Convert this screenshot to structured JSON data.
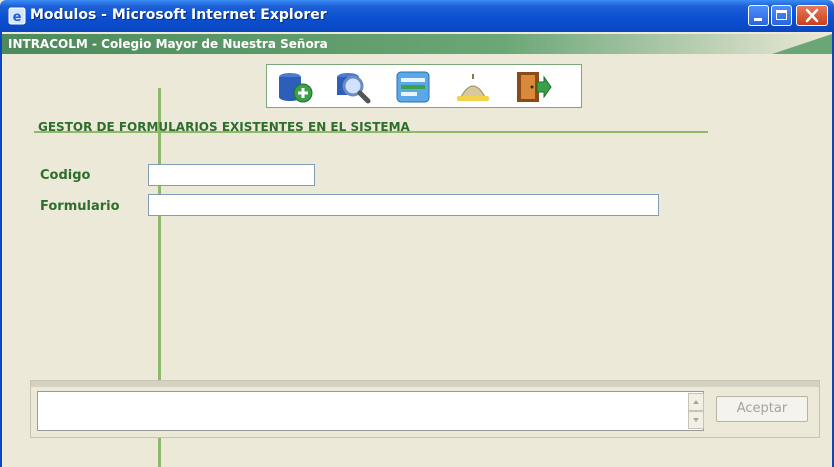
{
  "window": {
    "title": "Modulos - Microsoft Internet Explorer"
  },
  "banner": {
    "text": "INTRACOLM - Colegio Mayor de Nuestra Señora"
  },
  "toolbar": {
    "tools": [
      {
        "name": "add-record",
        "icon": "database-add-icon"
      },
      {
        "name": "search",
        "icon": "magnifier-icon"
      },
      {
        "name": "document",
        "icon": "document-icon"
      },
      {
        "name": "clear",
        "icon": "bell-icon"
      },
      {
        "name": "exit",
        "icon": "door-exit-icon"
      }
    ]
  },
  "section": {
    "title": "GESTOR DE FORMULARIOS EXISTENTES EN EL SISTEMA"
  },
  "form": {
    "codigo_label": "Codigo",
    "codigo_value": "",
    "formulario_label": "Formulario",
    "formulario_value": ""
  },
  "footer": {
    "message": "",
    "accept_label": "Aceptar"
  },
  "colors": {
    "titlebar": "#0a4fd0",
    "banner": "#4d8a5b",
    "accent_green": "#8fb86a",
    "label_green": "#2d6e2d"
  }
}
